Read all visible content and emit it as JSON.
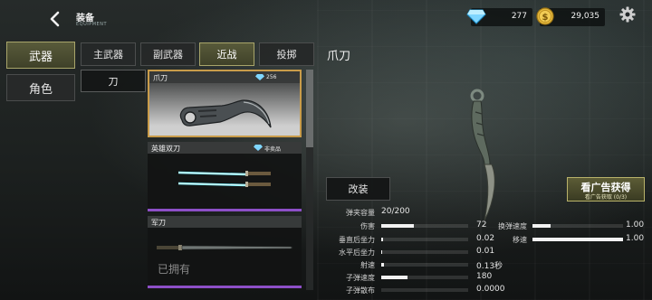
{
  "header": {
    "title": "装备",
    "subtitle": "EQUIPMENT"
  },
  "currency": {
    "gems": "277",
    "gold": "29,035"
  },
  "colors": {
    "accent_gold": "#c99c4a",
    "accent_olive": "#585a3a",
    "purple": "#8d4fc7",
    "gem": "#4fc7ff"
  },
  "categories": [
    {
      "label": "武器",
      "selected": true
    },
    {
      "label": "角色",
      "selected": false
    }
  ],
  "tabs": [
    {
      "label": "主武器"
    },
    {
      "label": "副武器"
    },
    {
      "label": "近战",
      "selected": true
    },
    {
      "label": "投掷"
    }
  ],
  "subtab": {
    "label": "刀"
  },
  "items": [
    {
      "name": "爪刀",
      "price": "256",
      "icon": "gem-icon"
    },
    {
      "name": "英雄双刀",
      "price": "非卖品",
      "icon": "gem-icon"
    },
    {
      "name": "军刀",
      "status": "已拥有"
    }
  ],
  "detail": {
    "title": "爪刀",
    "mod_label": "改装",
    "ad_label": "看广告获得",
    "ad_progress": "看广告获取 (0/3)",
    "stats_left": [
      {
        "label": "弹夹容量",
        "value": "20/200"
      },
      {
        "label": "伤害",
        "value": "72",
        "fill": 0.38
      },
      {
        "label": "垂直后坐力",
        "value": "0.02",
        "fill": 0.02
      },
      {
        "label": "水平后坐力",
        "value": "0.01",
        "fill": 0.01
      },
      {
        "label": "射速",
        "value": "0.13秒",
        "fill": 0.03
      },
      {
        "label": "子弹速度",
        "value": "180",
        "fill": 0.3
      },
      {
        "label": "子弹散布",
        "value": "0.0000",
        "fill": 0.0
      }
    ],
    "stats_right": [
      {
        "label": "换弹速度",
        "value": "1.00",
        "fill": 0.2
      },
      {
        "label": "移速",
        "value": "1.00",
        "fill": 1.0
      }
    ]
  }
}
